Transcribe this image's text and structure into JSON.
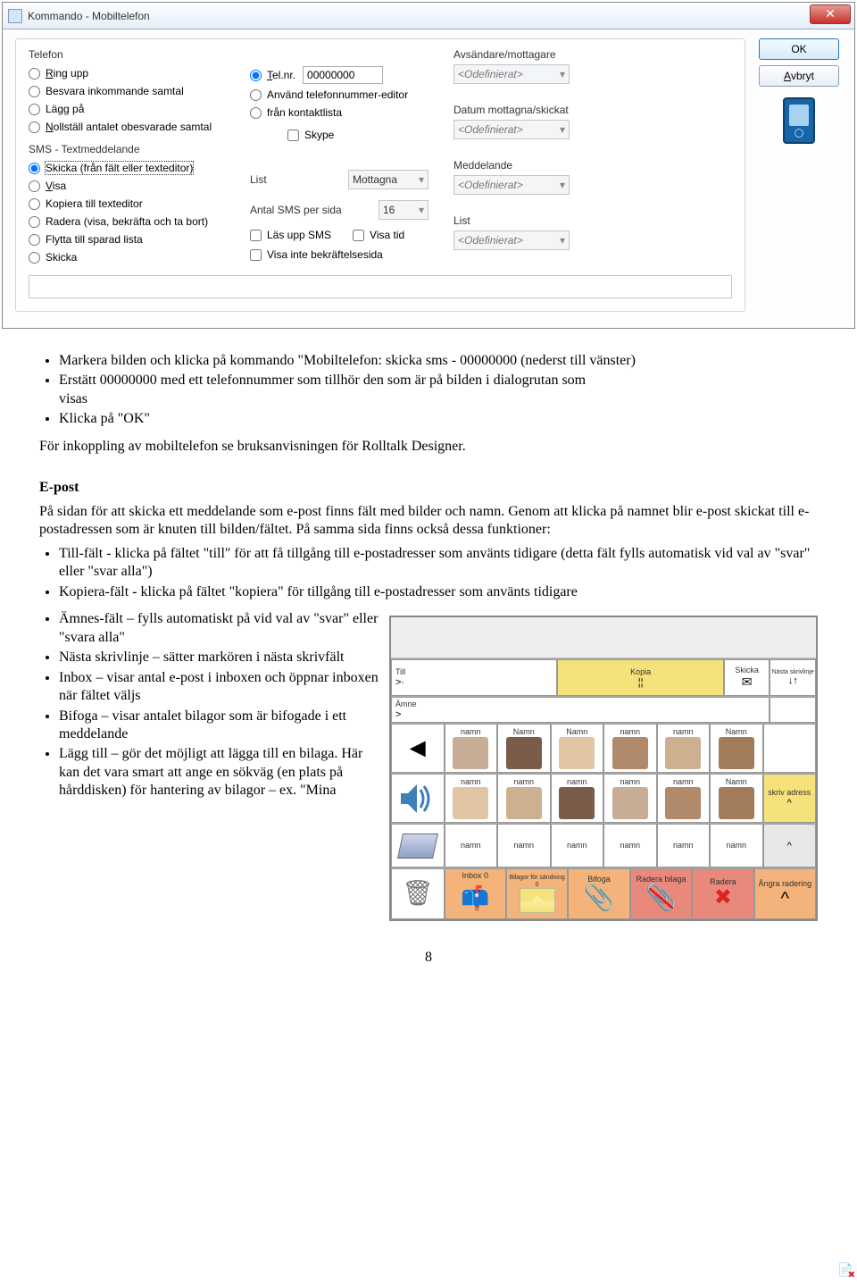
{
  "dialog": {
    "title": "Kommando - Mobiltelefon",
    "telefon": {
      "label": "Telefon",
      "opts": [
        "Ring upp",
        "Besvara inkommande samtal",
        "Lägg på",
        "Nollställ antalet obesvarade samtal"
      ]
    },
    "sms": {
      "label": "SMS - Textmeddelande",
      "opts": [
        "Skicka (från fält eller texteditor)",
        "Visa",
        "Kopiera till texteditor",
        "Radera (visa, bekräfta och ta bort)",
        "Flytta till sparad lista",
        "Skicka"
      ],
      "selected": 0
    },
    "mid": {
      "tel_label": "Tel.nr.",
      "tel_value": "00000000",
      "use_editor": "Använd telefonnummer-editor",
      "from_contacts": "från kontaktlista",
      "skype": "Skype",
      "list": "List",
      "list_value": "Mottagna",
      "per_page": "Antal SMS per sida",
      "per_page_value": "16",
      "read_sms": "Läs upp SMS",
      "show_time": "Visa tid",
      "no_confirm": "Visa inte bekräftelsesida"
    },
    "right": {
      "sender": "Avsändare/mottagare",
      "undef": "<Odefinierat>",
      "date": "Datum mottagna/skickat",
      "message": "Meddelande",
      "list": "List"
    },
    "buttons": {
      "ok": "OK",
      "cancel": "Avbryt"
    }
  },
  "doc": {
    "b1": [
      "Markera bilden och klicka på kommando \"Mobiltelefon: skicka sms - 00000000 (nederst till vänster)",
      "Erstätt 00000000 med ett telefonnummer som tillhör den som är på bilden i dialogrutan som visas",
      "Klicka på \"OK\""
    ],
    "p1": "För inkoppling av mobiltelefon se bruksanvisningen för Rolltalk Designer.",
    "h1": "E-post",
    "p2": "På sidan för att skicka ett meddelande som e-post finns fält med bilder och namn. Genom att klicka på namnet blir e-post skickat till e-postadressen som är knuten till bilden/fältet. På samma sida finns också dessa funktioner:",
    "b2": [
      "Till-fält - klicka på fältet \"till\" för att få tillgång till e-postadresser som använts tidigare (detta fält fylls automatisk vid val av \"svar\" eller \"svar alla\")",
      "Kopiera-fält - klicka på fältet \"kopiera\" för tillgång till e-postadresser som använts tidigare",
      "Ämnes-fält – fylls automatiskt på vid val av \"svar\" eller \"svara alla\"",
      "Nästa skrivlinje – sätter markören i nästa skrivfält",
      "Inbox – visar antal e-post i inboxen och öppnar inboxen när fältet väljs",
      "Bifoga – visar antalet bilagor som är bifogade i ett meddelande",
      "Lägg till – gör det möjligt att lägga till en bilaga. Här kan det vara smart att ange en sökväg (en plats på hårddisken) för hantering av bilagor – ex. \"Mina"
    ],
    "page": "8"
  },
  "app": {
    "row1": {
      "till": "Till",
      "till_sym": ">·",
      "kopia": "Kopia",
      "kopia_sym": "¦¦",
      "skicka": "Skicka",
      "nasta": "Nästa skrivlinje",
      "nasta_icon": "↓↑"
    },
    "row2": {
      "amne": "Ämne",
      "amne_sym": ">"
    },
    "namn": "namn",
    "Namn": "Namn",
    "skriv": "skriv adress",
    "caret": "^",
    "bottom": {
      "inbox": "Inbox 0",
      "bilagor": "Bilagor för sändning 0",
      "bifoga": "Bifoga",
      "radera_bilaga": "Radera bilaga",
      "radera": "Radera",
      "angra": "Ångra radering"
    }
  }
}
